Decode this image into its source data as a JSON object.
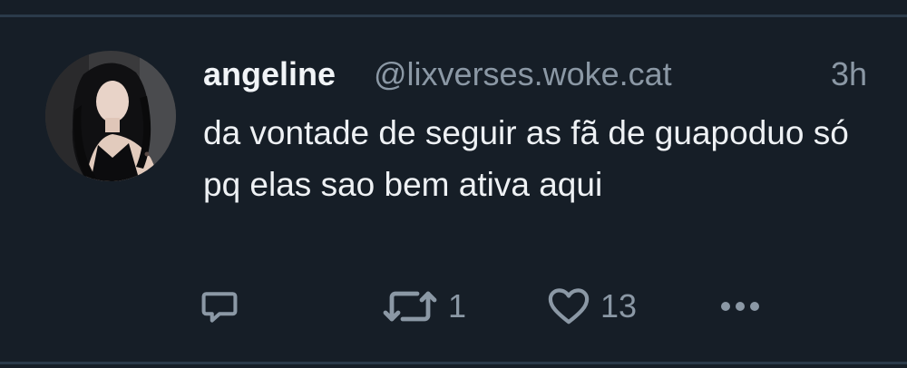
{
  "post": {
    "author": {
      "display_name": "angeline",
      "handle": "@lixverses.woke.cat"
    },
    "time_ago": "3h",
    "text": "da vontade de seguir as fã de guapoduo só pq elas sao bem ativa aqui"
  },
  "actions": {
    "repost_count": "1",
    "like_count": "13"
  },
  "icons": {
    "reply": "reply-icon",
    "repost": "repost-icon",
    "like": "heart-icon",
    "more": "more-options-icon"
  },
  "colors": {
    "background": "#161e27",
    "divider": "#2b3a4a",
    "primary_text": "#eef1f4",
    "secondary_text": "#8b98a5"
  }
}
